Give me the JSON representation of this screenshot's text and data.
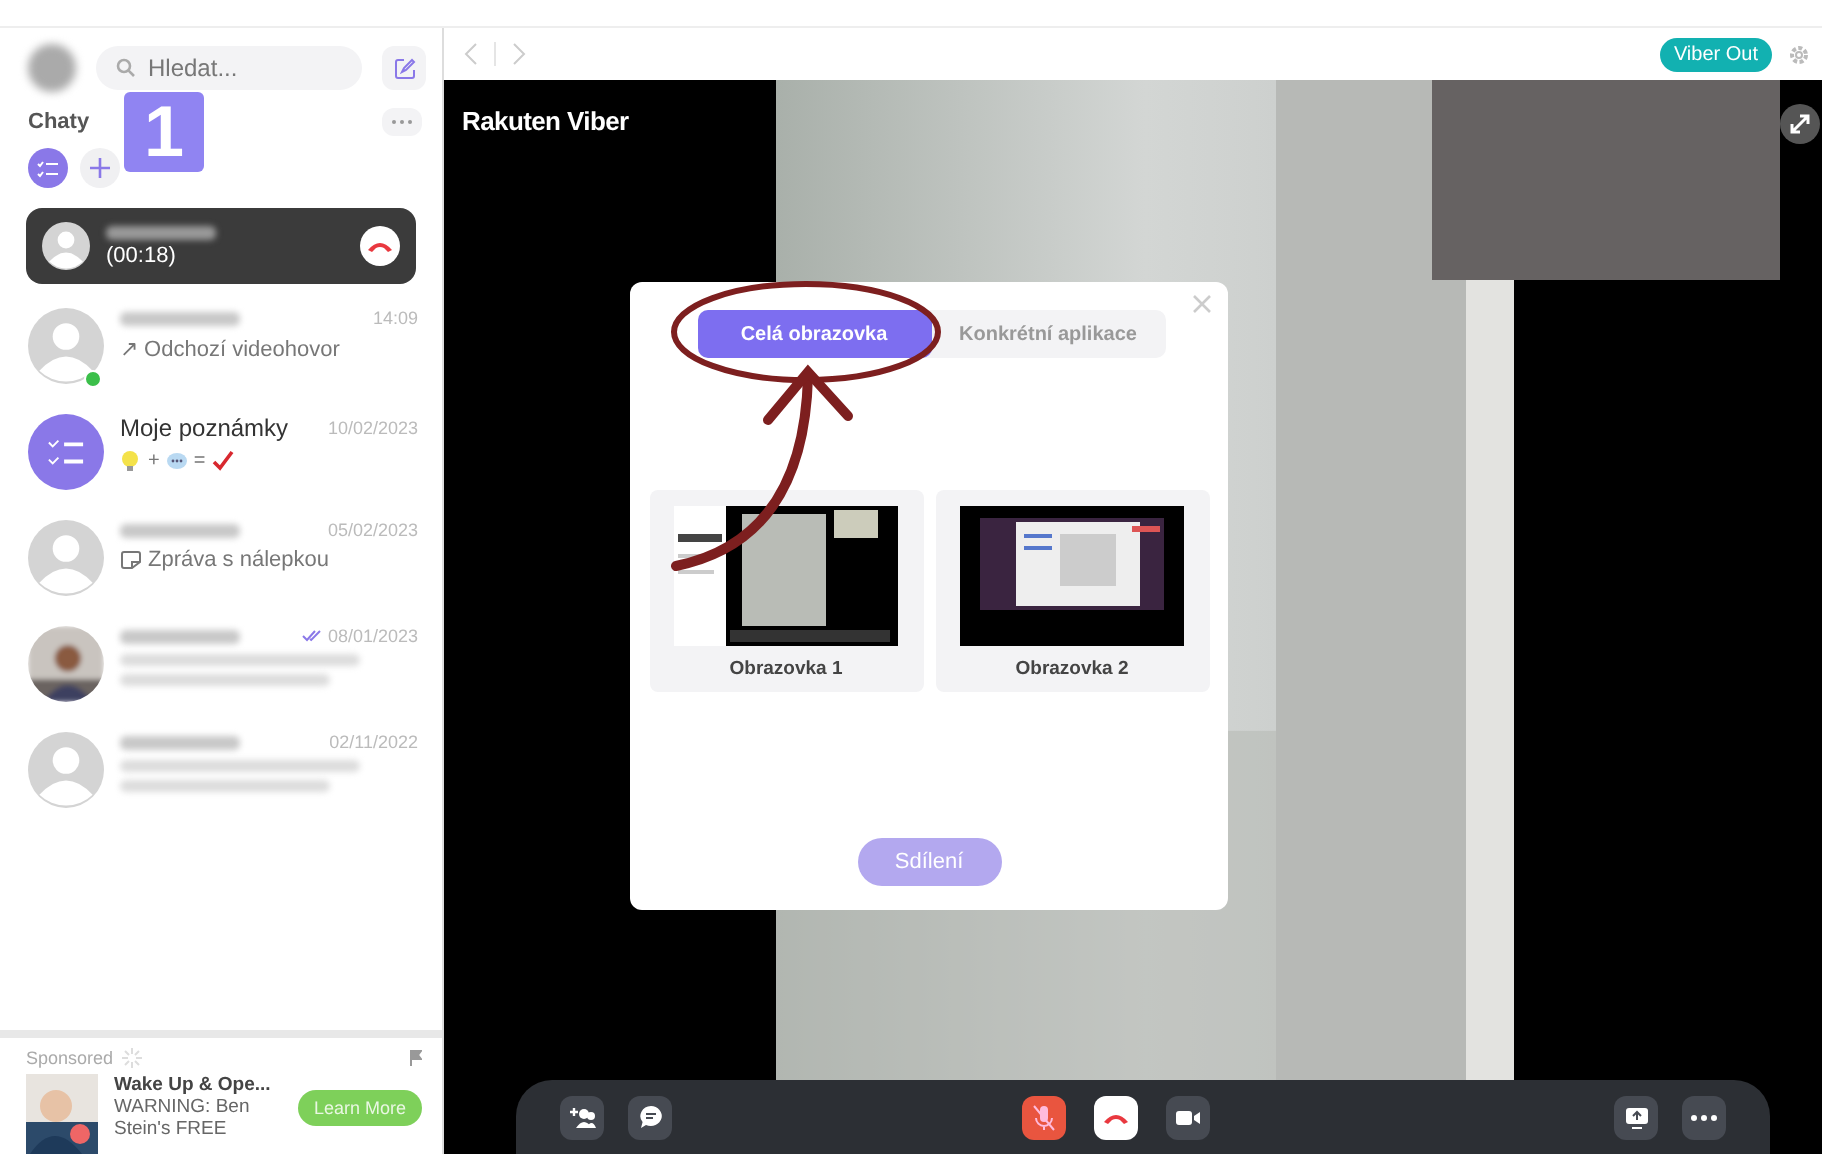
{
  "sidebar": {
    "search": {
      "placeholder": "Hledat..."
    },
    "section_title": "Chaty",
    "annotation_badge": "1",
    "active_call": {
      "duration": "(00:18)"
    },
    "chats": [
      {
        "kind": "contact",
        "time": "14:09",
        "preview": "↗ Odchozí videohovor",
        "online": true,
        "read": false
      },
      {
        "kind": "notes",
        "name": "Moje poznámky",
        "time": "10/02/2023",
        "preview_symbols": [
          "+",
          "="
        ],
        "online": false,
        "read": false
      },
      {
        "kind": "sticker",
        "time": "05/02/2023",
        "preview": "Zpráva s nálepkou",
        "online": false,
        "read": false
      },
      {
        "time": "08/01/2023",
        "online": false,
        "read": true
      },
      {
        "kind": "contact",
        "time": "02/11/2022",
        "online": false,
        "read": false
      }
    ],
    "ad": {
      "label": "Sponsored",
      "title": "Wake Up & Ope...",
      "text": "WARNING: Ben Stein's FREE",
      "button": "Learn More"
    }
  },
  "header": {
    "viber_out": "Viber Out"
  },
  "stage": {
    "logo": "Rakuten Viber"
  },
  "share_dialog": {
    "tabs": [
      {
        "label": "Celá obrazovka",
        "selected": true
      },
      {
        "label": "Konkrétní aplikace",
        "selected": false
      }
    ],
    "screens": [
      {
        "label": "Obrazovka 1",
        "kind": "video"
      },
      {
        "label": "Obrazovka 2",
        "kind": "desktop"
      }
    ],
    "share_button": {
      "label": "Sdílení",
      "disabled": true
    }
  },
  "call_controls": [
    {
      "kind": "add-people"
    },
    {
      "kind": "chat"
    },
    {
      "kind": "mic",
      "muted": true
    },
    {
      "kind": "hangup"
    },
    {
      "kind": "camera",
      "muted": false
    },
    {
      "kind": "screen-share"
    },
    {
      "kind": "more"
    }
  ]
}
